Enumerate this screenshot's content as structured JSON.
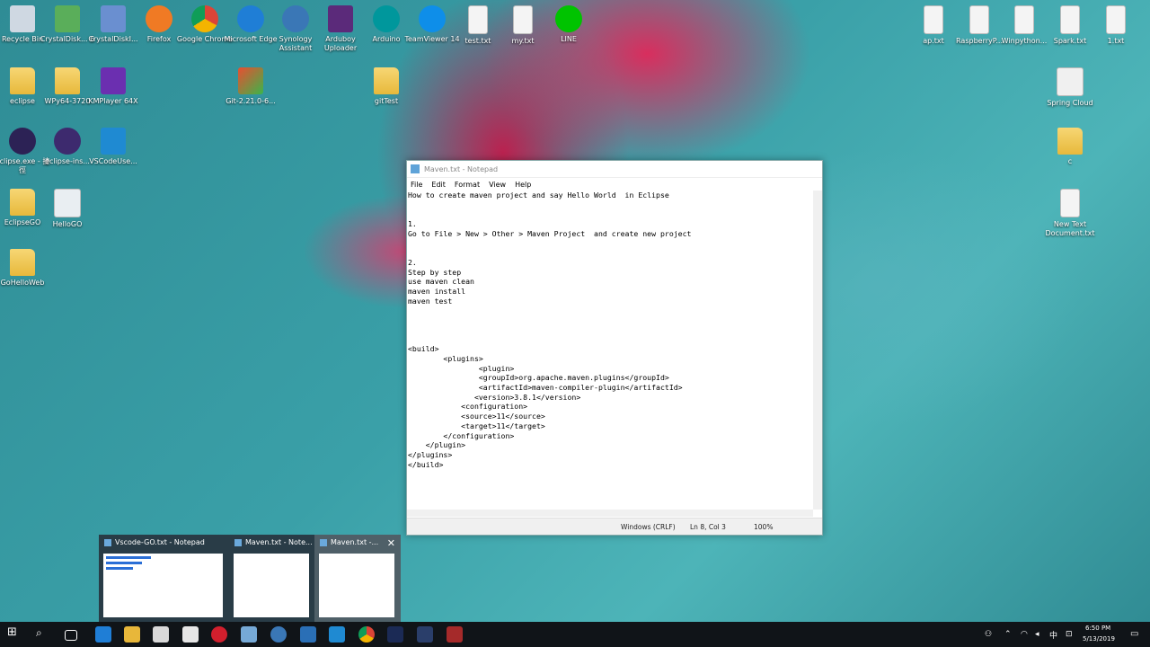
{
  "desktop": {
    "icons": [
      {
        "label": "Recycle Bin"
      },
      {
        "label": "CrystalDisk... 6"
      },
      {
        "label": "CrystalDiskI..."
      },
      {
        "label": "Firefox"
      },
      {
        "label": "Google Chrome"
      },
      {
        "label": "Microsoft Edge"
      },
      {
        "label": "Synology Assistant"
      },
      {
        "label": "Arduboy Uploader"
      },
      {
        "label": "Arduino"
      },
      {
        "label": "TeamViewer 14"
      },
      {
        "label": "test.txt"
      },
      {
        "label": "my.txt"
      },
      {
        "label": "LINE"
      },
      {
        "label": "ap.txt"
      },
      {
        "label": "RaspberryP..."
      },
      {
        "label": "Winpython..."
      },
      {
        "label": "Spark.txt"
      },
      {
        "label": "1.txt"
      },
      {
        "label": "eclipse"
      },
      {
        "label": "WPy64-3720"
      },
      {
        "label": "KMPlayer 64X"
      },
      {
        "label": "Git-2.21.0-6..."
      },
      {
        "label": "gitTest"
      },
      {
        "label": "Spring Cloud"
      },
      {
        "label": "eclipse.exe - 捷徑"
      },
      {
        "label": "eclipse-ins..."
      },
      {
        "label": "VSCodeUse..."
      },
      {
        "label": "c"
      },
      {
        "label": "EclipseGO"
      },
      {
        "label": "HelloGO"
      },
      {
        "label": "New Text Document.txt"
      },
      {
        "label": "GoHelloWeb"
      }
    ]
  },
  "notepad": {
    "title": "Maven.txt - Notepad",
    "menu": [
      "File",
      "Edit",
      "Format",
      "View",
      "Help"
    ],
    "content": "How to create maven project and say Hello World  in Eclipse\n\n\n1.\nGo to File > New > Other > Maven Project  and create new project\n\n\n2.\nStep by step\nuse maven clean\nmaven install\nmaven test\n\n\n\n\n<build>\n        <plugins>\n                <plugin>\n                <groupId>org.apache.maven.plugins</groupId>\n                <artifactId>maven-compiler-plugin</artifactId>\n               <version>3.8.1</version>\n            <configuration>\n            <source>11</source>\n            <target>11</target>\n        </configuration>\n    </plugin>\n</plugins>\n</build>",
    "status": {
      "encoding": "Windows (CRLF)",
      "position": "Ln 8, Col 3",
      "zoom": "100%"
    }
  },
  "taskbar_preview": {
    "items": [
      {
        "title": "Vscode-GO.txt - Notepad"
      },
      {
        "title": "Maven.txt - Note..."
      },
      {
        "title": "Maven.txt -..."
      }
    ]
  },
  "tray": {
    "time": "6:50 PM",
    "date": "5/13/2019",
    "ime": "中"
  }
}
